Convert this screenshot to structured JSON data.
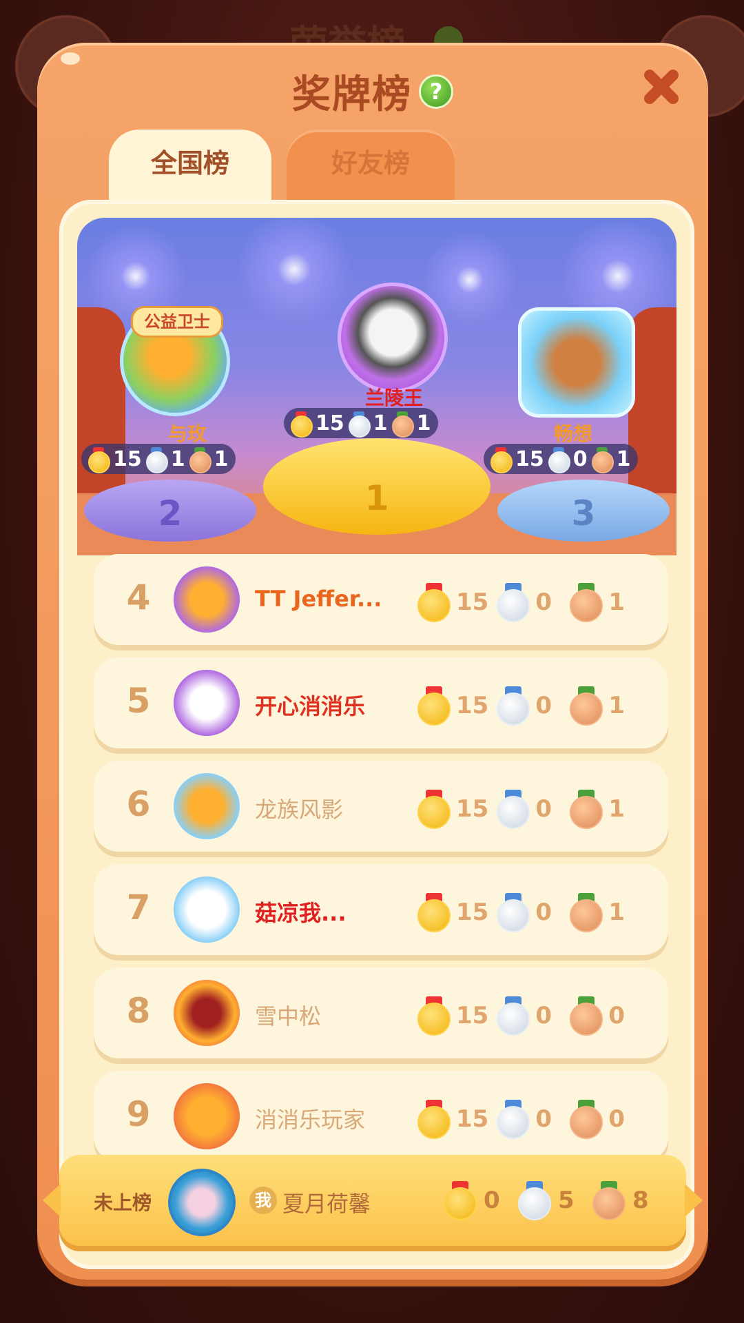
{
  "background": {
    "title": "荣誉榜"
  },
  "dialog": {
    "title": "奖牌榜",
    "help_icon": "?"
  },
  "tabs": [
    {
      "label": "全国榜",
      "active": true
    },
    {
      "label": "好友榜",
      "active": false
    }
  ],
  "podium": [
    {
      "place": "1",
      "name": "兰陵王",
      "gold": "15",
      "silver": "1",
      "bronze": "1",
      "avatar_badge": ""
    },
    {
      "place": "2",
      "name": "与玫",
      "gold": "15",
      "silver": "1",
      "bronze": "1",
      "avatar_badge": "公益卫士"
    },
    {
      "place": "3",
      "name": "畅想",
      "gold": "15",
      "silver": "0",
      "bronze": "1",
      "avatar_badge": ""
    }
  ],
  "rows": [
    {
      "rank": "4",
      "name": "TT Jeffer...",
      "gold": "15",
      "silver": "0",
      "bronze": "1"
    },
    {
      "rank": "5",
      "name": "开心消消乐",
      "gold": "15",
      "silver": "0",
      "bronze": "1"
    },
    {
      "rank": "6",
      "name": "龙族风影",
      "gold": "15",
      "silver": "0",
      "bronze": "1"
    },
    {
      "rank": "7",
      "name": "菇凉我...",
      "gold": "15",
      "silver": "0",
      "bronze": "1"
    },
    {
      "rank": "8",
      "name": "雪中松",
      "gold": "15",
      "silver": "0",
      "bronze": "0"
    },
    {
      "rank": "9",
      "name": "消消乐玩家",
      "gold": "15",
      "silver": "0",
      "bronze": "0"
    }
  ],
  "me": {
    "status": "未上榜",
    "tag": "我",
    "name": "夏月荷馨",
    "gold": "0",
    "silver": "5",
    "bronze": "8"
  },
  "colors": {
    "panel": "#f39c5f",
    "tab_active": "#fff4d6",
    "row_bg": "#fef5dd",
    "mine_bg": "#fbc24a"
  }
}
